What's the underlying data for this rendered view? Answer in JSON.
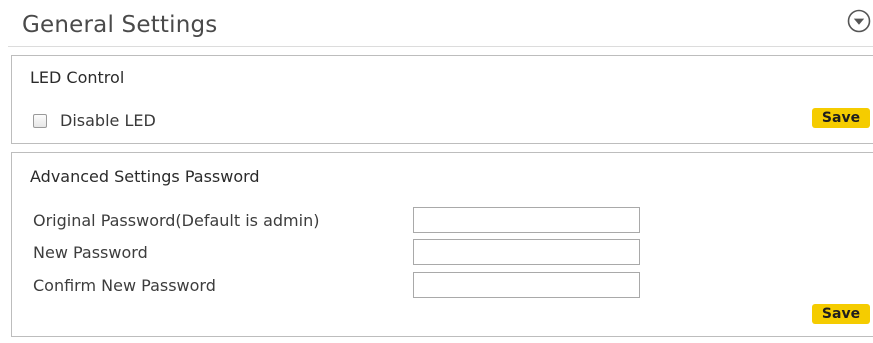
{
  "header": {
    "title": "General Settings",
    "collapse_icon": "chevron-down-circle-icon"
  },
  "led_control": {
    "title": "LED Control",
    "checkbox_label": "Disable LED",
    "checkbox_checked": false,
    "save_label": "Save"
  },
  "password": {
    "title": "Advanced Settings Password",
    "fields": [
      {
        "label": "Original Password(Default is admin)",
        "value": ""
      },
      {
        "label": "New Password",
        "value": ""
      },
      {
        "label": "Confirm New Password",
        "value": ""
      }
    ],
    "save_label": "Save"
  },
  "colors": {
    "save_button": "#f5cc00",
    "panel_border": "#bdbdbd",
    "title_text": "#4a4a4a"
  }
}
